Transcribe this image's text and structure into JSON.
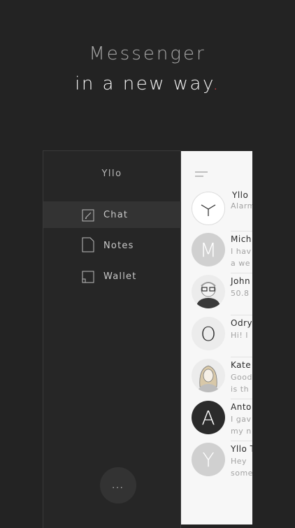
{
  "headline": {
    "line1": "Messenger",
    "line2": "in a new way",
    "accent_dot": "."
  },
  "drawer": {
    "app_name": "Yllo",
    "items": [
      {
        "label": "Chat",
        "icon": "edit-icon",
        "active": true
      },
      {
        "label": "Notes",
        "icon": "note-icon",
        "active": false
      },
      {
        "label": "Wallet",
        "icon": "wallet-icon",
        "active": false
      }
    ],
    "more_label": "..."
  },
  "chats": [
    {
      "name": "Yllo",
      "message": "Alarm",
      "avatar": "clock-logo"
    },
    {
      "name": "Mich",
      "message": "I hav\na we",
      "avatar_letter": "M"
    },
    {
      "name": "John",
      "message": "50.8",
      "avatar": "photo"
    },
    {
      "name": "Odry",
      "message": "Hi! I",
      "avatar_letter": "O"
    },
    {
      "name": "Kate",
      "message": "Good\nis th",
      "avatar": "photo"
    },
    {
      "name": "Anto",
      "message": "I gav\nmy n",
      "avatar_letter": "A"
    },
    {
      "name": "Yllo T",
      "message": "Hey\nsome",
      "avatar_letter": "Y"
    }
  ],
  "colors": {
    "accent": "#e0414a",
    "background": "#232323",
    "panel": "#f7f7f7"
  }
}
